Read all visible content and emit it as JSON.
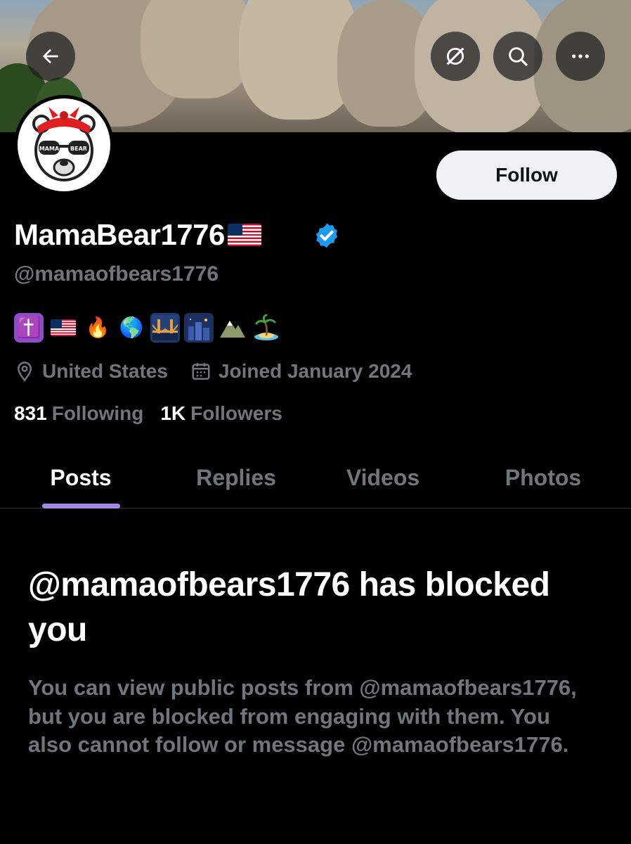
{
  "header": {
    "back_icon": "arrow-left-icon",
    "grok_icon": "grok-icon",
    "search_icon": "search-icon",
    "more_icon": "more-horizontal-icon"
  },
  "profile": {
    "display_name": "MamaBear1776",
    "handle": "@mamaofbears1776",
    "verified_color": "#1d9bf0",
    "bio_emoji": [
      "✝️",
      "🇺🇸",
      "🔥",
      "🌎",
      "🌉",
      "🌃",
      "⛰️",
      "🏝️"
    ],
    "location": "United States",
    "joined": "Joined January 2024",
    "following_count": "831",
    "following_label": "Following",
    "followers_count": "1K",
    "followers_label": "Followers",
    "avatar_text": "MAMA BEAR"
  },
  "follow_button": {
    "label": "Follow"
  },
  "tabs": [
    {
      "label": "Posts",
      "active": true
    },
    {
      "label": "Replies",
      "active": false
    },
    {
      "label": "Videos",
      "active": false
    },
    {
      "label": "Photos",
      "active": false
    }
  ],
  "blocked": {
    "title": "@mamaofbears1776 has blocked you",
    "description": "You can view public posts from @mamaofbears1776, but you are blocked from engaging with them. You also cannot follow or message @mamaofbears1776."
  },
  "colors": {
    "accent_indicator": "#a48ae8",
    "muted_text": "#71767b",
    "background": "#000000"
  }
}
